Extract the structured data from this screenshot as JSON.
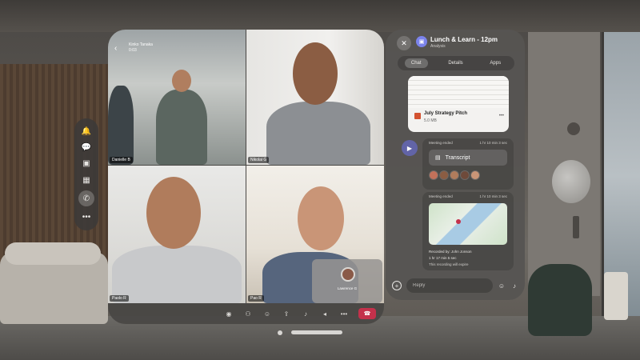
{
  "environment": {
    "colors": {
      "wood": "#5a4737",
      "window_light": "#b9c0c4",
      "wall": "#7c7873"
    }
  },
  "rail": {
    "items": [
      {
        "icon": "bell-icon",
        "glyph": "🔔"
      },
      {
        "icon": "chat-icon",
        "glyph": "💬"
      },
      {
        "icon": "teams-icon",
        "glyph": "▣"
      },
      {
        "icon": "calendar-icon",
        "glyph": "▦"
      },
      {
        "icon": "phone-icon",
        "glyph": "✆"
      },
      {
        "icon": "more-icon",
        "glyph": "•••"
      }
    ]
  },
  "meeting": {
    "back_glyph": "‹",
    "overlay_title": "Kinko Tanaka",
    "overlay_time": "0:03",
    "participants": [
      {
        "name": "Danielle B",
        "tile": "top-left"
      },
      {
        "name": "Nikolai G",
        "tile": "top-right"
      },
      {
        "name": "Paolo R",
        "tile": "bottom-left"
      },
      {
        "name": "Pao R",
        "tile": "bottom-right"
      }
    ],
    "self_view_name": "Lawrence G"
  },
  "controls": {
    "items": [
      {
        "icon": "camera-icon",
        "glyph": "◉"
      },
      {
        "icon": "people-icon",
        "glyph": "⚇"
      },
      {
        "icon": "reactions-icon",
        "glyph": "☺"
      },
      {
        "icon": "share-icon",
        "glyph": "⇪"
      },
      {
        "icon": "mic-icon",
        "glyph": "♪"
      },
      {
        "icon": "speaker-icon",
        "glyph": "◂"
      },
      {
        "icon": "more-icon",
        "glyph": "•••"
      }
    ],
    "hangup_glyph": "☎",
    "hangup_color": "#c4314b"
  },
  "panel": {
    "close_glyph": "✕",
    "title": "Lunch & Learn - 12pm",
    "subtitle": "Analysis",
    "tabs": [
      "Chat",
      "Details",
      "Apps"
    ],
    "active_tab": "Chat",
    "file": {
      "name": "July Strategy Pitch",
      "size": "5.0 MB",
      "more": "•••"
    },
    "messages": [
      {
        "meta": "Meeting ended",
        "time": "1 hr 10 min 3 sec",
        "pill": "Transcript"
      },
      {
        "meta": "Meeting ended",
        "time": "1 hr 10 min 3 sec",
        "recorded_by": "Recorded by: John Jonson",
        "duration": "1 hr 17 min 5 sec",
        "expiry": "This recording will expire"
      }
    ],
    "reply_placeholder": "Reply"
  }
}
